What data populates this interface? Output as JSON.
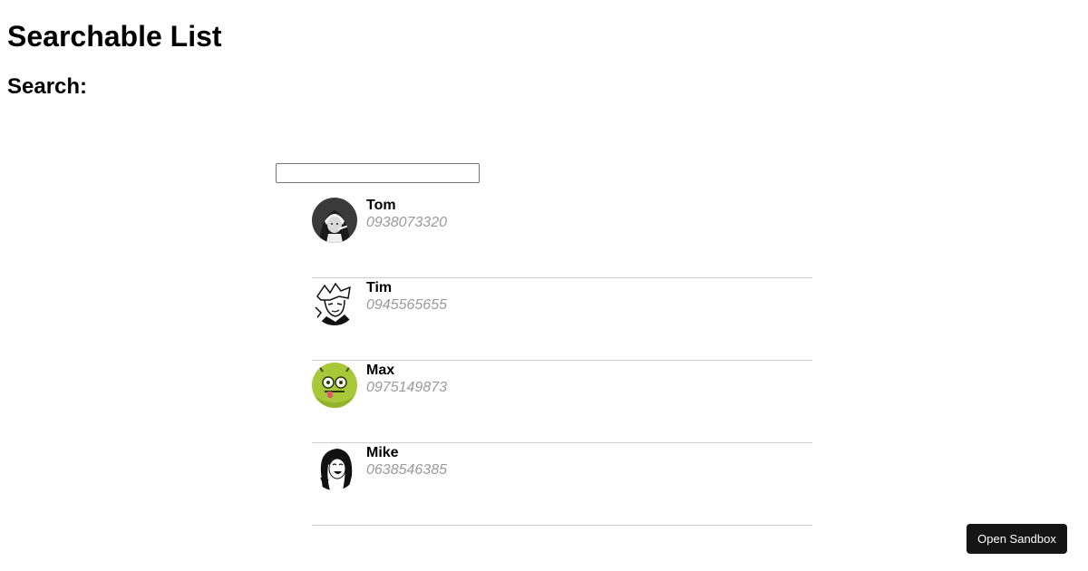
{
  "page": {
    "title": "Searchable List",
    "search_label": "Search:"
  },
  "search": {
    "value": "",
    "placeholder": ""
  },
  "contacts": [
    {
      "name": "Tom",
      "phone": "0938073320",
      "avatar_icon": "nun-avatar-icon"
    },
    {
      "name": "Tim",
      "phone": "0945565655",
      "avatar_icon": "manga-boy-avatar-icon"
    },
    {
      "name": "Max",
      "phone": "0975149873",
      "avatar_icon": "green-monster-avatar-icon"
    },
    {
      "name": "Mike",
      "phone": "0638546385",
      "avatar_icon": "manga-girl-avatar-icon"
    }
  ],
  "footer": {
    "open_sandbox_label": "Open Sandbox"
  },
  "colors": {
    "phone_text": "#9a9a9a",
    "divider": "#cfcfcf",
    "button_bg": "#151515",
    "max_avatar": "#a8c83a"
  }
}
